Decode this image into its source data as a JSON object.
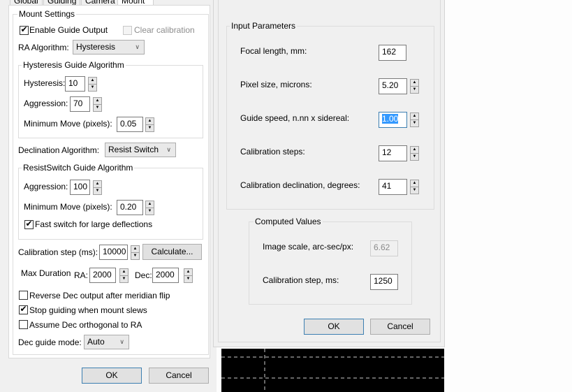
{
  "left_dialog": {
    "tabs": [
      {
        "label": "Global",
        "active": false
      },
      {
        "label": "Guiding",
        "active": false
      },
      {
        "label": "Camera",
        "active": false
      },
      {
        "label": "Mount",
        "active": true
      }
    ],
    "mount_settings": {
      "title": "Mount Settings",
      "enable_guide_output": {
        "label": "Enable Guide Output",
        "checked": true
      },
      "clear_calibration": {
        "label": "Clear calibration",
        "checked": false,
        "disabled": true
      },
      "ra_algorithm": {
        "label": "RA Algorithm:",
        "value": "Hysteresis"
      },
      "hysteresis_group": {
        "title": "Hysteresis Guide Algorithm",
        "hysteresis": {
          "label": "Hysteresis:",
          "value": "10"
        },
        "aggression": {
          "label": "Aggression:",
          "value": "70"
        },
        "min_move": {
          "label": "Minimum Move (pixels):",
          "value": "0.05"
        }
      },
      "dec_algorithm": {
        "label": "Declination Algorithm:",
        "value": "Resist Switch"
      },
      "resist_switch_group": {
        "title": "ResistSwitch Guide Algorithm",
        "aggression": {
          "label": "Aggression:",
          "value": "100"
        },
        "min_move": {
          "label": "Minimum Move (pixels):",
          "value": "0.20"
        },
        "fast_switch": {
          "label": "Fast switch for large deflections",
          "checked": true
        }
      },
      "calibration_step": {
        "label": "Calibration step (ms):",
        "value": "10000",
        "calculate_label": "Calculate..."
      },
      "max_duration": {
        "label": "Max Duration",
        "ra_label": "RA:",
        "ra_value": "2000",
        "dec_label": "Dec:",
        "dec_value": "2000"
      },
      "reverse_dec": {
        "label": "Reverse Dec output after meridian flip",
        "checked": false
      },
      "stop_guiding": {
        "label": "Stop guiding when mount slews",
        "checked": true
      },
      "assume_orthogonal": {
        "label": "Assume Dec orthogonal to RA",
        "checked": false
      },
      "dec_guide_mode": {
        "label": "Dec guide mode:",
        "value": "Auto"
      }
    },
    "ok_label": "OK",
    "cancel_label": "Cancel"
  },
  "right_dialog": {
    "input_parameters": {
      "title": "Input Parameters",
      "focal_length": {
        "label": "Focal length, mm:",
        "value": "162"
      },
      "pixel_size": {
        "label": "Pixel size, microns:",
        "value": "5.20"
      },
      "guide_speed": {
        "label": "Guide speed, n.nn x sidereal:",
        "value": "1.00"
      },
      "calibration_steps": {
        "label": "Calibration steps:",
        "value": "12"
      },
      "calibration_declination": {
        "label": "Calibration declination, degrees:",
        "value": "41"
      }
    },
    "computed_values": {
      "title": "Computed Values",
      "image_scale": {
        "label": "Image scale, arc-sec/px:",
        "value": "6.62"
      },
      "calibration_step": {
        "label": "Calibration step, ms:",
        "value": "1250"
      }
    },
    "ok_label": "OK",
    "cancel_label": "Cancel"
  },
  "colors": {
    "dialog_bg": "#f0f0f0",
    "selection": "#3399ff",
    "focus_border": "#3c7fb1",
    "preview_bg": "#000000"
  }
}
